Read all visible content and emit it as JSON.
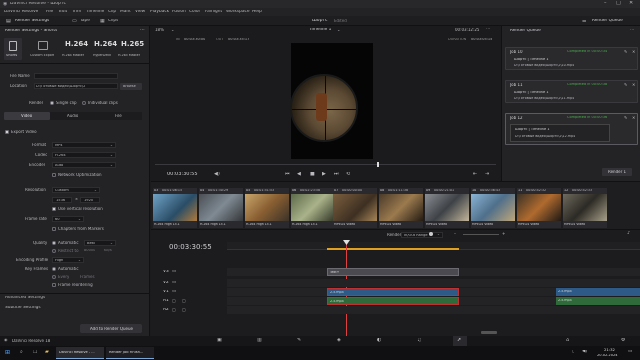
{
  "titlebar": {
    "title": "DaVinci Resolve - Шортс"
  },
  "menu": [
    "DaVinci Resolve",
    "File",
    "Edit",
    "Trim",
    "Timeline",
    "Clip",
    "Mark",
    "View",
    "Playback",
    "Fusion",
    "Color",
    "Fairlight",
    "Workspace",
    "Help"
  ],
  "toolbar": {
    "render_settings": "Render Settings",
    "tape": "Tape",
    "clips": "Clips",
    "project": "Шортс",
    "edited": "Edited",
    "render_queue": "Render Queue"
  },
  "render": {
    "panel_title": "Render Settings - Shorts",
    "presets": [
      {
        "name": "Shorts",
        "big": ""
      },
      {
        "name": "Custom Export",
        "big": ""
      },
      {
        "name": "H.264 Master",
        "big": "H.264"
      },
      {
        "name": "HyperDeck",
        "big": "H.264"
      },
      {
        "name": "H.265 Master",
        "big": "H.265"
      }
    ],
    "filename_label": "File Name",
    "location_label": "Location",
    "location_value": "D:\\Готовые видео\\Шортс\\2",
    "browse": "Browse",
    "render_label": "Render",
    "single_clip": "Single clip",
    "individual_clips": "Individual clips",
    "tabs": [
      "Video",
      "Audio",
      "File"
    ],
    "export_video": "Export Video",
    "format_label": "Format",
    "format_value": "MP4",
    "codec_label": "Codec",
    "codec_value": "H.264",
    "encoder_label": "Encoder",
    "encoder_value": "Auto",
    "network_opt": "Network Optimization",
    "resolution_label": "Resolution",
    "resolution_value": "Custom",
    "res_w": "1536",
    "res_h": "1920",
    "vertical": "Use vertical resolution",
    "framerate_label": "Frame rate",
    "framerate_value": "60",
    "chapters": "Chapters from Markers",
    "quality_label": "Quality",
    "automatic": "Automatic",
    "quality_value": "Best",
    "restrict": "Restrict to",
    "restrict_value": "80000",
    "kbs": "Kb/s",
    "profile_label": "Encoding Profile",
    "profile_value": "High",
    "keyframes_label": "Key Frames",
    "every": "Every",
    "frames": "Frames",
    "reordering": "Frame reordering",
    "advanced": "Advanced Settings",
    "subtitle": "Subtitle Settings",
    "add_queue": "Add to Render Queue"
  },
  "viewer": {
    "zoom": "18%",
    "in_label": "IN",
    "in_tc": "00:03:30:00",
    "out_label": "OUT",
    "out_tc": "00:03:35:17",
    "timeline": "Timeline 1",
    "tc_top": "00:03:12:25",
    "duration_label": "DURATION",
    "duration": "00:03:05:15",
    "playhead": "00:03:30:55"
  },
  "queue": {
    "title": "Render Queue",
    "jobs": [
      {
        "name": "Job 10",
        "status": "Completed in 00:00:34",
        "line1": "Шортс | Timeline 1",
        "path": "D:\\Готовые видео\\Шортс\\2\\10.mp4"
      },
      {
        "name": "Job 11",
        "status": "Completed in 00:00:38",
        "line1": "Шортс | Timeline 1",
        "path": "D:\\Готовые видео\\Шортс\\2\\11.mp4"
      },
      {
        "name": "Job 12",
        "status": "Completed in 00:00:36",
        "line1": "Шортс | Timeline 1",
        "path": "D:\\Готовые видео\\Шортс\\2\\12.mp4"
      }
    ],
    "render_button": "Render 1"
  },
  "clips": [
    {
      "num": "03",
      "tc": "00:01:06:15",
      "v": "V1",
      "name": "H.264 High L5.1"
    },
    {
      "num": "04",
      "tc": "00:01:30:29",
      "v": "V1",
      "name": "H.264 High L5.1"
    },
    {
      "num": "05",
      "tc": "00:01:51:53",
      "v": "V1",
      "name": "H.264 High L5.1"
    },
    {
      "num": "06",
      "tc": "00:02:23:58",
      "v": "V1",
      "name": "H.264 High L5.1"
    },
    {
      "num": "07",
      "tc": "00:00:00:00",
      "v": "V1",
      "name": "MPEG4 Video"
    },
    {
      "num": "08",
      "tc": "00:01:11:38",
      "v": "V1",
      "name": "MPEG4 Video"
    },
    {
      "num": "09",
      "tc": "00:00:21:01",
      "v": "V1",
      "name": "MPEG4 Video"
    },
    {
      "num": "10",
      "tc": "00:00:36:43",
      "v": "V1",
      "name": "MPEG4 Video"
    },
    {
      "num": "11",
      "tc": "00:00:42:32",
      "v": "V1",
      "name": "MPEG4 Video"
    },
    {
      "num": "12",
      "tc": "00:00:42:33",
      "v": "V1",
      "name": "MPEG4 Video"
    }
  ],
  "timeline": {
    "render_label": "Render",
    "range": "In/Out Range",
    "timecode": "00:03:30:55",
    "tracks": [
      "V3",
      "V2",
      "V1",
      "A1",
      "A2"
    ],
    "clip_text": "Text+",
    "clip_v1": "2.5.mp4",
    "clip_a1": "2.5.mp4",
    "clip_v1b": "2.5.mp4",
    "clip_a1b": "2.5.mp4"
  },
  "status": {
    "app": "DaVinci Resolve 18"
  },
  "taskbar": {
    "app1": "DaVinci Resolve - ...",
    "app2": "Render Job Finish...",
    "time": "21:32",
    "date": "20.02.2024"
  }
}
